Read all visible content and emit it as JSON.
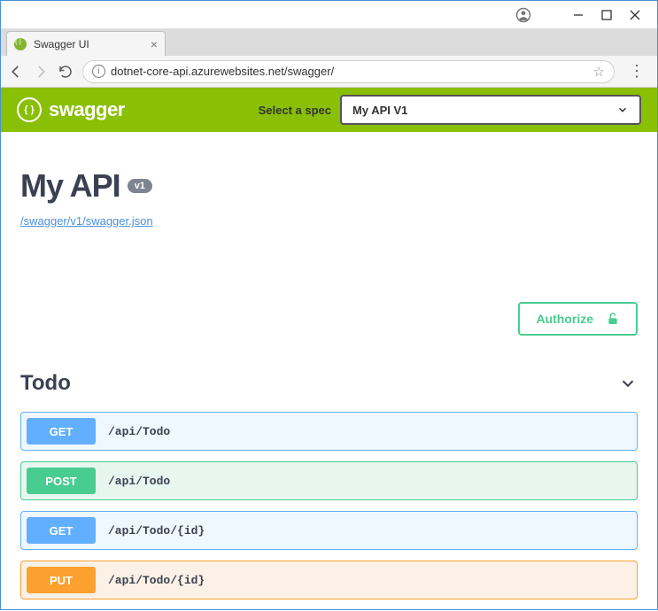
{
  "window": {
    "tab_title": "Swagger UI",
    "url": "dotnet-core-api.azurewebsites.net/swagger/"
  },
  "swagger_header": {
    "brand": "swagger",
    "spec_label": "Select a spec",
    "spec_selected": "My API V1"
  },
  "api": {
    "title": "My API",
    "version": "v1",
    "spec_link": "/swagger/v1/swagger.json"
  },
  "authorize_label": "Authorize",
  "section": {
    "name": "Todo",
    "operations": [
      {
        "method": "GET",
        "path": "/api/Todo",
        "cls": "op-get"
      },
      {
        "method": "POST",
        "path": "/api/Todo",
        "cls": "op-post"
      },
      {
        "method": "GET",
        "path": "/api/Todo/{id}",
        "cls": "op-get"
      },
      {
        "method": "PUT",
        "path": "/api/Todo/{id}",
        "cls": "op-put"
      }
    ]
  }
}
